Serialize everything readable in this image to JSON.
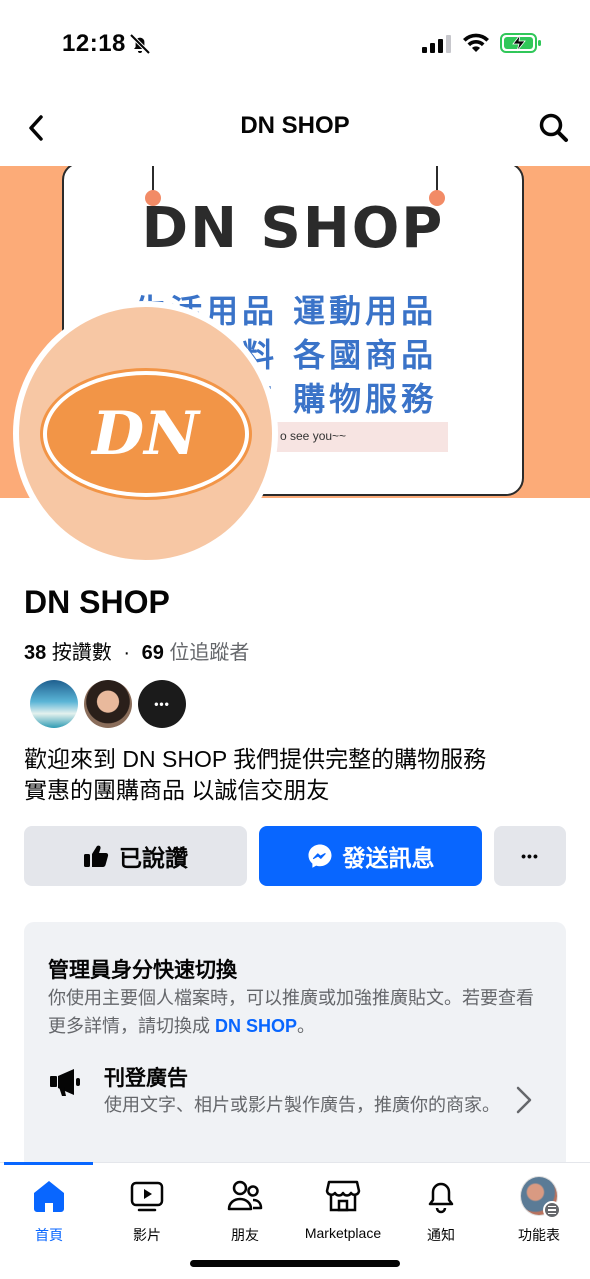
{
  "status_bar": {
    "time": "12:18"
  },
  "nav": {
    "title": "DN SHOP"
  },
  "cover": {
    "title": "DN SHOP",
    "line1": "生活用品 運動用品",
    "line2": "美妝資料 各國商品",
    "line3": "團購代售 購物服務",
    "tagline": "o see you~~"
  },
  "avatar": {
    "text": "DN"
  },
  "profile": {
    "name": "DN SHOP",
    "likes_count": "38",
    "likes_label": "按讚數",
    "separator": "·",
    "followers_count": "69",
    "followers_label": "位追蹤者",
    "bio_line1": "歡迎來到 DN SHOP 我們提供完整的購物服務",
    "bio_line2": "實惠的團購商品 以誠信交朋友"
  },
  "actions": {
    "liked_label": "已說讚",
    "message_label": "發送訊息",
    "more_label": "•••"
  },
  "admin": {
    "title": "管理員身分快速切換",
    "desc_prefix": "你使用主要個人檔案時，可以推廣或加強推廣貼文。若要查看更多詳情，請切換成 ",
    "desc_link": "DN SHOP",
    "desc_suffix": "。",
    "ad_title": "刊登廣告",
    "ad_desc": "使用文字、相片或影片製作廣告，推廣你的商家。"
  },
  "tabs": [
    {
      "label": "首頁",
      "icon": "home-icon"
    },
    {
      "label": "影片",
      "icon": "video-icon"
    },
    {
      "label": "朋友",
      "icon": "friends-icon"
    },
    {
      "label": "Marketplace",
      "icon": "marketplace-icon"
    },
    {
      "label": "通知",
      "icon": "bell-icon"
    },
    {
      "label": "功能表",
      "icon": "menu-icon"
    }
  ],
  "colors": {
    "accent": "#0866ff",
    "cover": "#fcab78",
    "logo": "#f29547"
  }
}
